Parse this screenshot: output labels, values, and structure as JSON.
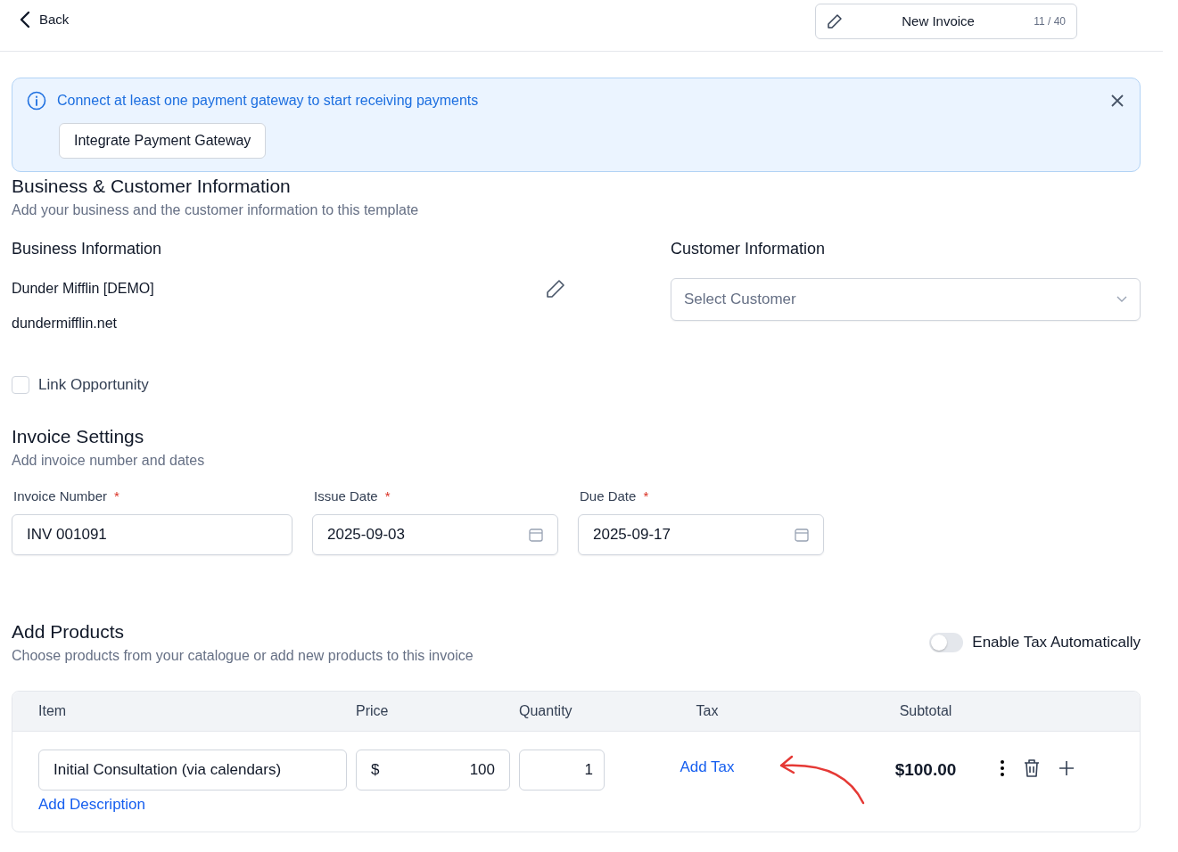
{
  "header": {
    "back": "Back",
    "title": "New Invoice",
    "counter": "11 / 40"
  },
  "alert": {
    "message": "Connect at least one payment gateway to start receiving payments",
    "button": "Integrate Payment Gateway"
  },
  "business_customer": {
    "title": "Business & Customer Information",
    "subtitle": "Add your business and the customer information to this template",
    "business": {
      "heading": "Business Information",
      "name": "Dunder Mifflin [DEMO]",
      "website": "dundermifflin.net"
    },
    "customer": {
      "heading": "Customer Information",
      "placeholder": "Select Customer"
    }
  },
  "link_opportunity": {
    "label": "Link Opportunity",
    "checked": false
  },
  "invoice_settings": {
    "title": "Invoice Settings",
    "subtitle": "Add invoice number and dates",
    "fields": [
      {
        "kind": "text",
        "label": "Invoice Number",
        "required_mark": "*",
        "value": "INV 001091"
      },
      {
        "kind": "date",
        "label": "Issue Date",
        "required_mark": "*",
        "value": "2025-09-03"
      },
      {
        "kind": "date",
        "label": "Due Date",
        "required_mark": "*",
        "value": "2025-09-17"
      }
    ]
  },
  "products": {
    "title": "Add Products",
    "subtitle": "Choose products from your catalogue or add new products to this invoice",
    "tax_toggle": {
      "label": "Enable Tax Automatically",
      "on": false
    },
    "columns": [
      "Item",
      "Price",
      "Quantity",
      "Tax",
      "Subtotal"
    ],
    "rows": [
      {
        "item": "Initial Consultation (via calendars)",
        "description_link": "Add Description",
        "currency": "$",
        "price": "100",
        "quantity": "1",
        "tax_link": "Add Tax",
        "subtotal": "$100.00"
      }
    ]
  }
}
